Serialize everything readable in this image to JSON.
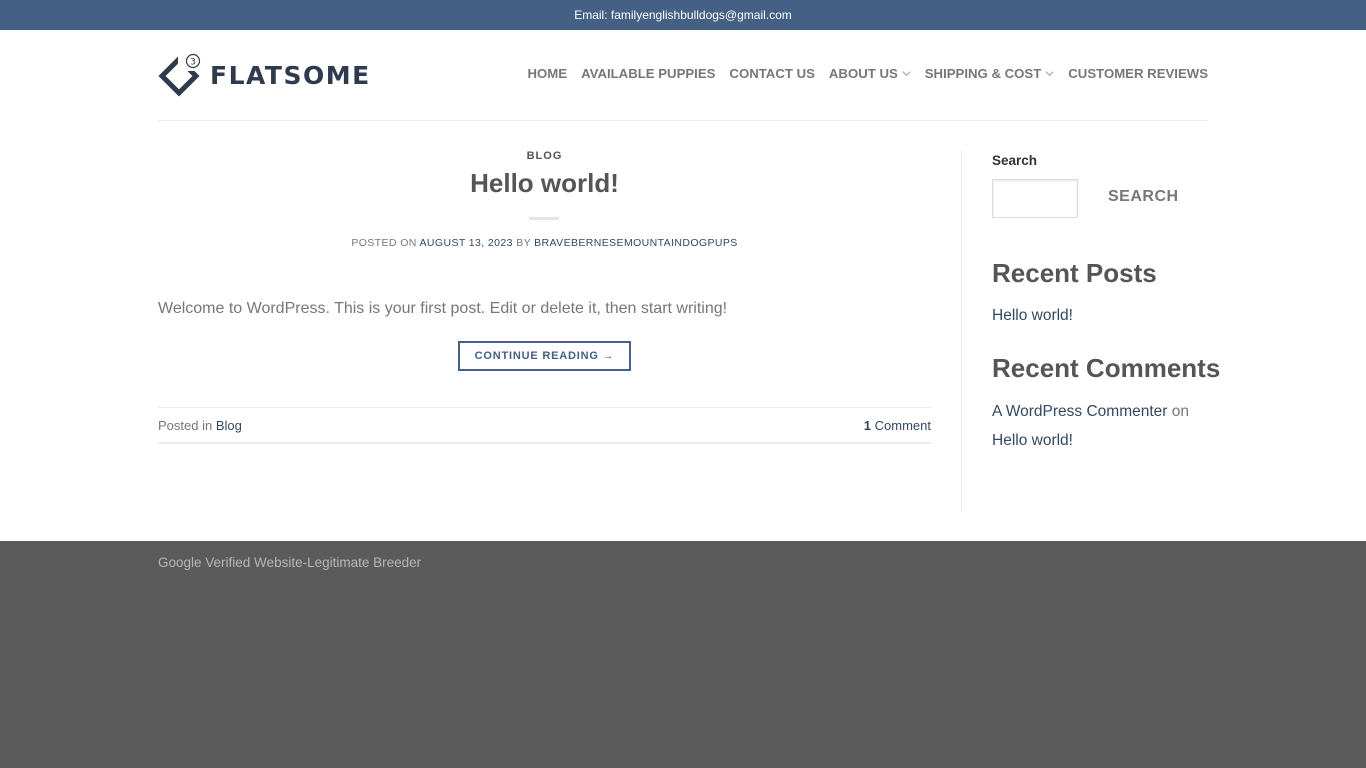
{
  "topbar": {
    "email": "Email: familyenglishbulldogs@gmail.com"
  },
  "header": {
    "logo_text": "FLATSOME",
    "logo_badge": "3",
    "nav": [
      {
        "label": "HOME",
        "dropdown": false
      },
      {
        "label": "AVAILABLE PUPPIES",
        "dropdown": false
      },
      {
        "label": "CONTACT US",
        "dropdown": false
      },
      {
        "label": "ABOUT US",
        "dropdown": true
      },
      {
        "label": "SHIPPING & COST",
        "dropdown": true
      },
      {
        "label": "CUSTOMER REVIEWS",
        "dropdown": false
      }
    ]
  },
  "post": {
    "category": "BLOG",
    "title": "Hello world!",
    "meta_posted_on": "POSTED ON",
    "meta_date": "AUGUST 13, 2023",
    "meta_by": "BY",
    "meta_author": "BRAVEBERNESEMOUNTAINDOGPUPS",
    "excerpt": "Welcome to WordPress. This is your first post. Edit or delete it, then start writing!",
    "continue_label": "CONTINUE READING →",
    "posted_in_label": "Posted in",
    "posted_in_link": "Blog",
    "comment_count": "1",
    "comment_label": "Comment"
  },
  "sidebar": {
    "search_label": "Search",
    "search_value": "",
    "search_button": "SEARCH",
    "recent_posts_title": "Recent Posts",
    "recent_posts": [
      "Hello world!"
    ],
    "recent_comments_title": "Recent Comments",
    "comment_author": "A WordPress Commenter",
    "comment_on": "on",
    "comment_post": "Hello world!"
  },
  "footer": {
    "text": "Google Verified Website-Legitimate Breeder"
  },
  "colors": {
    "primary": "#446084",
    "link": "#334862",
    "footer_bg": "#5b5b5b"
  }
}
